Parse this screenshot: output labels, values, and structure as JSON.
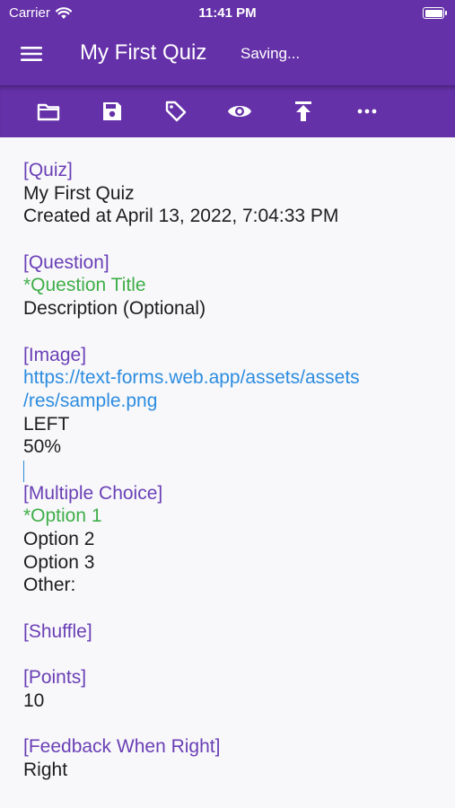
{
  "status_bar": {
    "carrier": "Carrier",
    "time": "11:41 PM"
  },
  "app_bar": {
    "title": "My First Quiz",
    "status": "Saving..."
  },
  "toolbar": {
    "items": [
      {
        "icon": "folder-icon"
      },
      {
        "icon": "save-icon"
      },
      {
        "icon": "tag-icon"
      },
      {
        "icon": "eye-icon"
      },
      {
        "icon": "upload-icon"
      },
      {
        "icon": "more-icon"
      }
    ]
  },
  "colors": {
    "primary": "#6531a8",
    "section": "#6a3fb6",
    "required": "#3fae49",
    "link": "#2c8ce0",
    "text": "#1d1d1f"
  },
  "content": {
    "quiz_header": "[Quiz]",
    "quiz_title": "My First Quiz",
    "created_at": "Created at April 13, 2022, 7:04:33 PM",
    "question_header": "[Question]",
    "question_title": "*Question Title",
    "question_description": "Description (Optional)",
    "image_header": "[Image]",
    "image_url_line1": "https://text-forms.web.app/assets/assets",
    "image_url_line2": "/res/sample.png",
    "image_align": "LEFT",
    "image_size": "50%",
    "choice_header": "[Multiple Choice]",
    "option1": "*Option 1",
    "option2": "Option 2",
    "option3": "Option 3",
    "option_other": "Other:",
    "shuffle_header": "[Shuffle]",
    "points_header": "[Points]",
    "points_value": "10",
    "feedback_header": "[Feedback When Right]",
    "feedback_value": "Right"
  }
}
